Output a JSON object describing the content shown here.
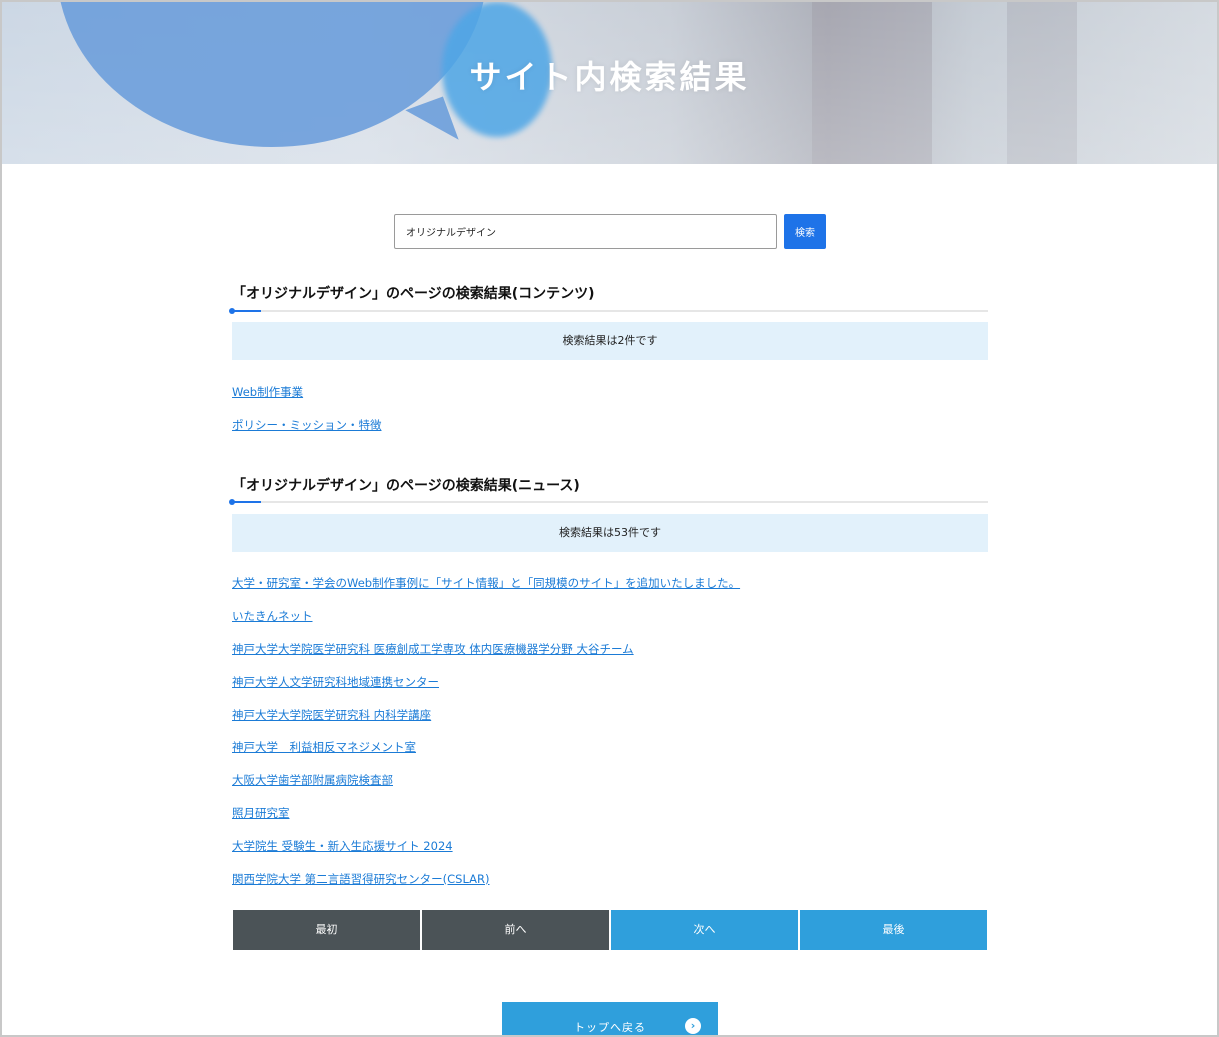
{
  "hero": {
    "title": "サイト内検索結果"
  },
  "search": {
    "value": "オリジナルデザイン",
    "button_label": "検索"
  },
  "contents_section": {
    "heading": "「オリジナルデザイン」のページの検索結果(コンテンツ)",
    "count_text": "検索結果は2件です",
    "results": [
      "Web制作事業",
      "ポリシー・ミッション・特徴"
    ]
  },
  "news_section": {
    "heading": "「オリジナルデザイン」のページの検索結果(ニュース)",
    "count_text": "検索結果は53件です",
    "results": [
      "大学・研究室・学会のWeb制作事例に「サイト情報」と「同規模のサイト」を追加いたしました。",
      "いたきんネット",
      "神戸大学大学院医学研究科 医療創成工学専攻 体内医療機器学分野 大谷チーム",
      "神戸大学人文学研究科地域連携センター",
      "神戸大学大学院医学研究科 内科学講座",
      "神戸大学　利益相反マネジメント室",
      "大阪大学歯学部附属病院検査部",
      "照月研究室",
      "大学院生 受験生・新入生応援サイト 2024",
      "関西学院大学 第二言語習得研究センター(CSLAR)"
    ]
  },
  "pagination": {
    "first": "最初",
    "prev": "前へ",
    "next": "次へ",
    "last": "最後"
  },
  "back_to_top": {
    "label": "トップへ戻る",
    "icon": "chevron-right-circle-icon"
  },
  "colors": {
    "accent_blue": "#1e73e8",
    "pager_blue": "#2f9fdc",
    "pager_dark": "#4b5357",
    "count_bg": "#e2f1fb",
    "link": "#1b7bd6"
  }
}
